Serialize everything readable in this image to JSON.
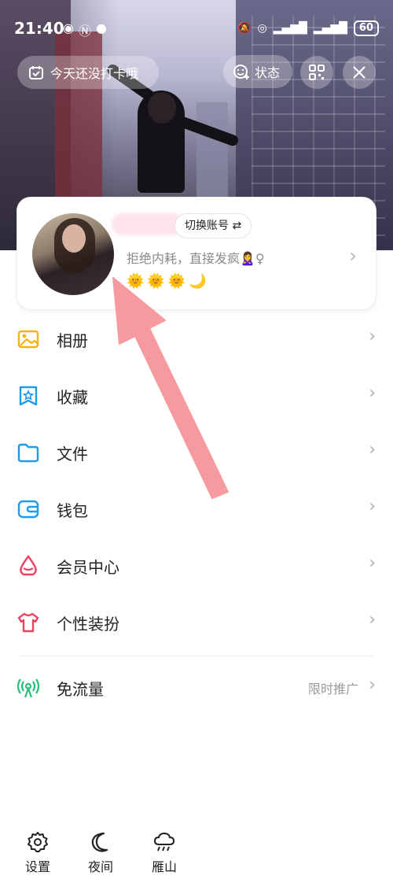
{
  "status_bar": {
    "time": "21:40",
    "battery": "60"
  },
  "header": {
    "checkin_label": "今天还没打卡哦",
    "status_label": "状态"
  },
  "profile": {
    "switch_account_label": "切换账号 ⇄",
    "signature": "拒绝内耗，直接发疯🙎‍♀️♀",
    "level_badges": [
      "🌞",
      "🌞",
      "🌞",
      "🌙"
    ]
  },
  "menu": {
    "items": [
      {
        "label": "相册",
        "icon": "photo-album-icon",
        "color": "#f2b31a"
      },
      {
        "label": "收藏",
        "icon": "favorites-icon",
        "color": "#1e9be9"
      },
      {
        "label": "文件",
        "icon": "folder-icon",
        "color": "#1e9be9"
      },
      {
        "label": "钱包",
        "icon": "wallet-icon",
        "color": "#1e9be9"
      },
      {
        "label": "会员中心",
        "icon": "vip-icon",
        "color": "#f0425f"
      },
      {
        "label": "个性装扮",
        "icon": "dress-up-icon",
        "color": "#f0425f"
      }
    ],
    "free_data": {
      "label": "免流量",
      "icon": "broadcast-icon",
      "extra": "限时推广",
      "color": "#2bbf7a"
    }
  },
  "bottom_bar": {
    "settings_label": "设置",
    "night_label": "夜间",
    "weather_label": "雁山"
  },
  "annotation_color": "#f79a9f"
}
